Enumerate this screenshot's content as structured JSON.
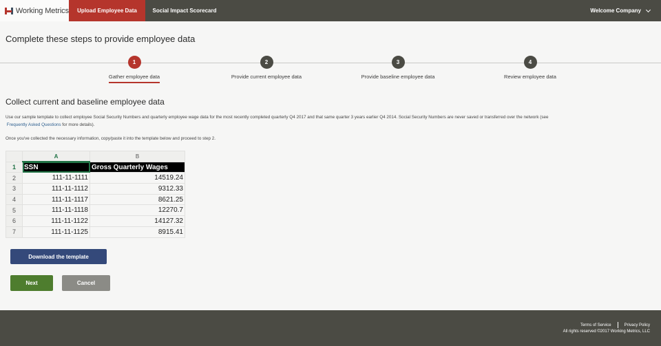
{
  "header": {
    "brand": "Working Metrics",
    "tabs": [
      {
        "label": "Upload Employee Data"
      },
      {
        "label": "Social Impact Scorecard"
      }
    ],
    "user_menu": "Welcome Company"
  },
  "page_title": "Complete these steps to provide employee data",
  "steps": [
    {
      "number": "1",
      "label": "Gather employee data"
    },
    {
      "number": "2",
      "label": "Provide current employee data"
    },
    {
      "number": "3",
      "label": "Provide baseline employee data"
    },
    {
      "number": "4",
      "label": "Review employee data"
    }
  ],
  "active_step": 1,
  "section": {
    "heading": "Collect current and baseline employee data",
    "description_text": "Use our sample template to collect employee Social Security Numbers and quarterly employee wage data for the most recently completed quarterly Q4 2017 and that same quarter 3 years earlier Q4 2014. Social Security Numbers are never saved or transferred over the network (see",
    "faq_link": "Frequently Asked Questions",
    "description_tail": "for more details).",
    "instruction": "Once you've collected the necessary information, copy/paste it into the template below and proceed to step 2."
  },
  "spreadsheet": {
    "column_letters": [
      "A",
      "B"
    ],
    "headers": [
      "SSN",
      "Gross Quarterly Wages"
    ],
    "rows": [
      {
        "n": "2",
        "ssn": "111-11-1111",
        "wages": "14519.24"
      },
      {
        "n": "3",
        "ssn": "111-11-1112",
        "wages": "9312.33"
      },
      {
        "n": "4",
        "ssn": "111-11-1117",
        "wages": "8621.25"
      },
      {
        "n": "5",
        "ssn": "111-11-1118",
        "wages": "12270.7"
      },
      {
        "n": "6",
        "ssn": "111-11-1122",
        "wages": "14127.32"
      },
      {
        "n": "7",
        "ssn": "111-11-1125",
        "wages": "8915.41"
      }
    ],
    "header_row_number": "1"
  },
  "buttons": {
    "download": "Download the template",
    "next": "Next",
    "cancel": "Cancel"
  },
  "footer": {
    "terms": "Terms of Service",
    "privacy": "Privacy Policy",
    "copyright": "All rights reserved ©2017 Working Metrics, LLC"
  },
  "colors": {
    "nav_bg": "#4b4b44",
    "accent_red": "#b5352c",
    "download_blue": "#34497a",
    "next_green": "#4e7d2e",
    "cancel_gray": "#8b8b86"
  }
}
